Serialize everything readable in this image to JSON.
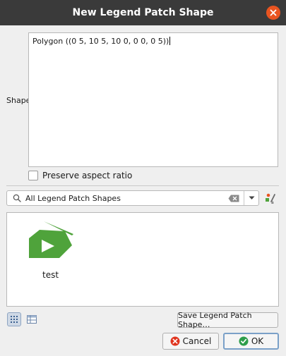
{
  "dialog": {
    "title": "New Legend Patch Shape"
  },
  "shape": {
    "label": "Shape",
    "value": "Polygon ((0 5, 10 5, 10 0, 0 0, 0 5))"
  },
  "preserve_aspect": {
    "label": "Preserve aspect ratio",
    "checked": false
  },
  "search": {
    "value": "All Legend Patch Shapes"
  },
  "library": {
    "items": [
      {
        "label": "test",
        "icon": "green-polygon-patch-icon"
      }
    ],
    "view_mode": "icon-view"
  },
  "buttons": {
    "save": "Save Legend Patch Shape…",
    "cancel": "Cancel",
    "ok": "OK"
  },
  "colors": {
    "titlebar": "#3a3a3a",
    "close": "#e95420",
    "patch_green": "#4fa33b",
    "ok_border": "#7aa0c8"
  }
}
